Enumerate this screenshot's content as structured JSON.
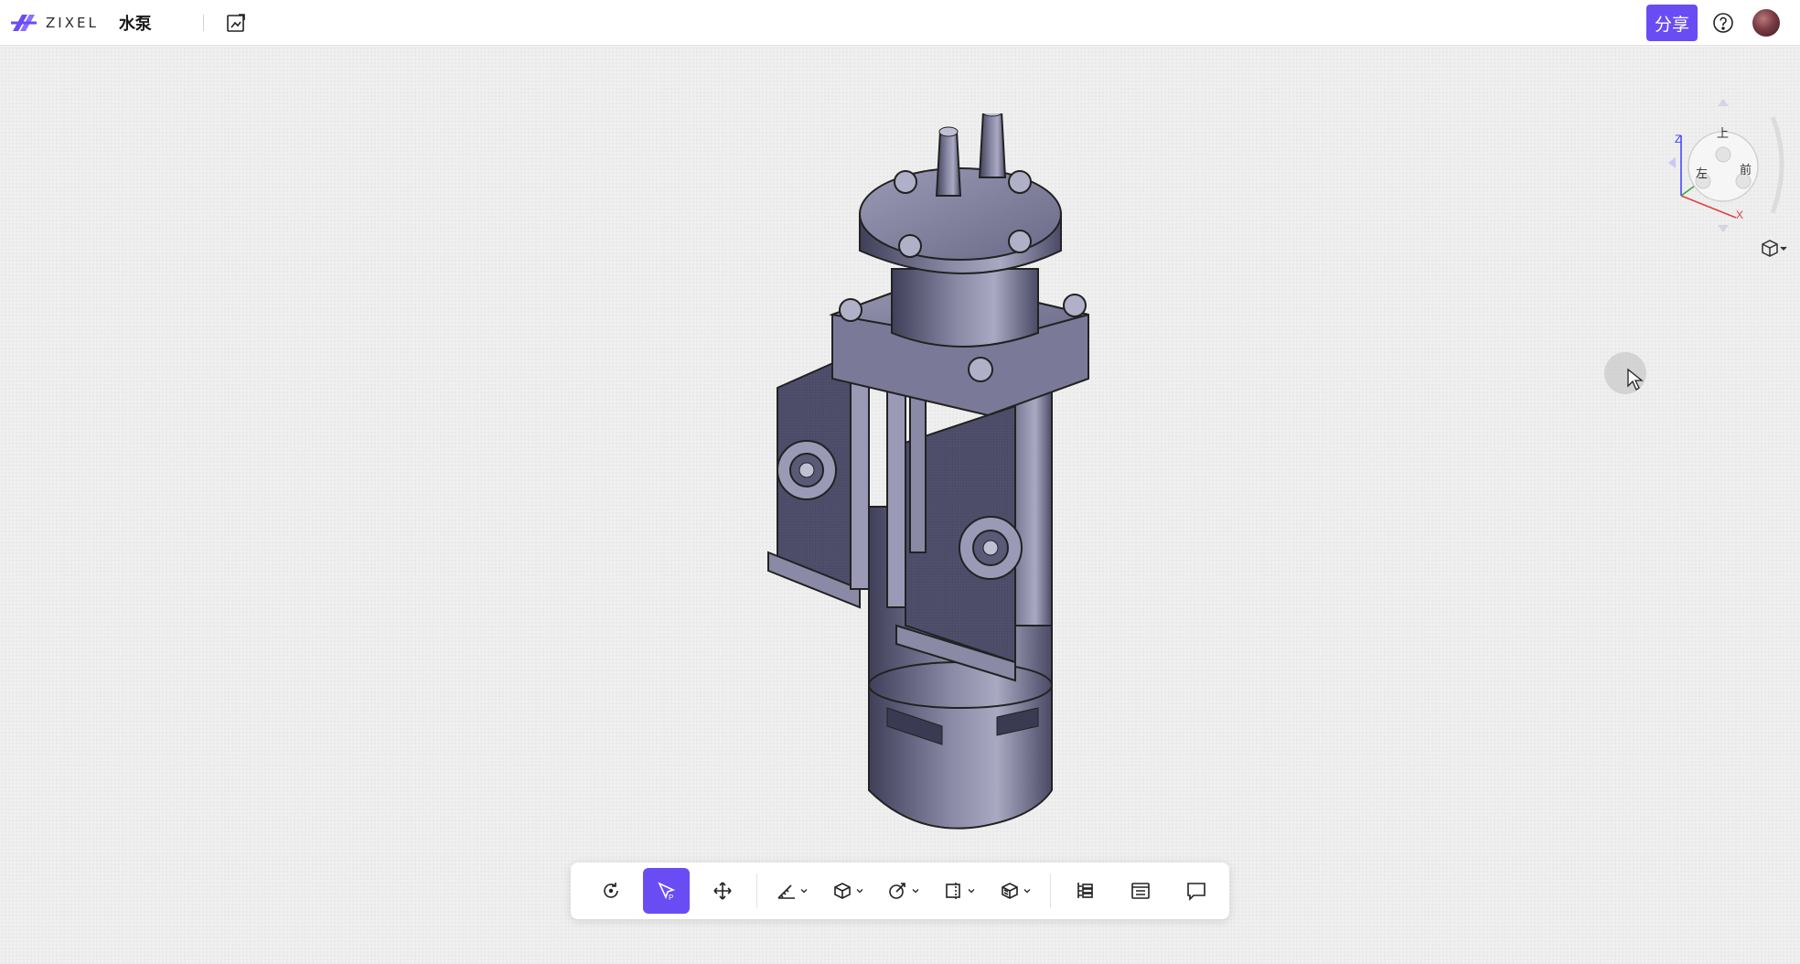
{
  "header": {
    "logo_text": "ZIXEL",
    "doc_title": "水泵",
    "share_label": "分享"
  },
  "icons": {
    "logo": "zixel-logo-icon",
    "edit": "edit-image-icon",
    "help": "help-circle-icon",
    "avatar": "user-avatar"
  },
  "viewcube": {
    "faces": {
      "top": "上",
      "left": "左",
      "front": "前"
    },
    "axes": {
      "z": "Z",
      "x": "X"
    }
  },
  "toolbar": {
    "items": [
      {
        "name": "rotate-icon",
        "active": false,
        "dropdown": false
      },
      {
        "name": "select-icon",
        "active": true,
        "dropdown": false
      },
      {
        "name": "move-icon",
        "active": false,
        "dropdown": false
      },
      {
        "name": "measure-icon",
        "active": false,
        "dropdown": true
      },
      {
        "name": "view-mode-icon",
        "active": false,
        "dropdown": true
      },
      {
        "name": "explode-icon",
        "active": false,
        "dropdown": true
      },
      {
        "name": "section-icon",
        "active": false,
        "dropdown": true
      },
      {
        "name": "display-icon",
        "active": false,
        "dropdown": true
      },
      {
        "name": "structure-tree-icon",
        "active": false,
        "dropdown": false
      },
      {
        "name": "properties-icon",
        "active": false,
        "dropdown": false
      },
      {
        "name": "comment-icon",
        "active": false,
        "dropdown": false
      }
    ]
  },
  "colors": {
    "accent": "#6a4cf4",
    "model_body": "#5a5a78",
    "background": "#efefef"
  }
}
